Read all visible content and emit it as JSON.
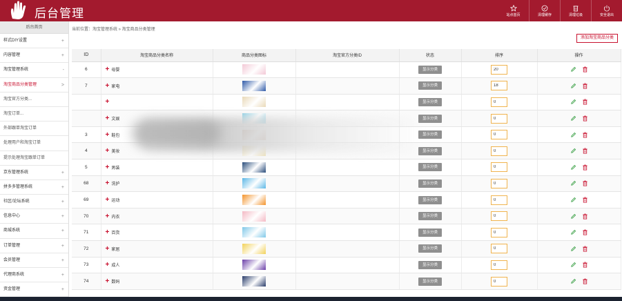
{
  "header": {
    "title": "后台管理",
    "nav": [
      {
        "label": "站点首页",
        "icon": "star-icon"
      },
      {
        "label": "清理缓存",
        "icon": "clear-cache-icon"
      },
      {
        "label": "清理垃圾",
        "icon": "trash-icon"
      },
      {
        "label": "安全退出",
        "icon": "power-icon"
      }
    ]
  },
  "sidebar": {
    "home": "后台首页",
    "items": [
      {
        "label": "样式DIY设置",
        "arrow": "+"
      },
      {
        "label": "内容管理",
        "arrow": "+"
      },
      {
        "label": "淘宝管理系统",
        "arrow": "-"
      },
      {
        "label": "淘宝商品分类管理",
        "arrow": ">",
        "active": true
      },
      {
        "label": "淘宝官方分类...",
        "arrow": ""
      },
      {
        "label": "淘宝订单...",
        "arrow": ""
      },
      {
        "label": "外部跟单淘宝订单",
        "arrow": ""
      },
      {
        "label": "处理用户和淘宝订单",
        "arrow": ""
      },
      {
        "label": "提示处理淘宝跟单订单",
        "arrow": ""
      },
      {
        "label": "京东管理系统",
        "arrow": "+"
      },
      {
        "label": "拼多多管理系统",
        "arrow": "+"
      },
      {
        "label": "社区/论坛系统",
        "arrow": "+"
      },
      {
        "label": "信息中心",
        "arrow": "+"
      },
      {
        "label": "商城系统",
        "arrow": "+"
      },
      {
        "label": "订单管理",
        "arrow": "+"
      },
      {
        "label": "会员管理",
        "arrow": "+"
      },
      {
        "label": "代理商系统",
        "arrow": "+"
      },
      {
        "label": "资金管理",
        "arrow": "+"
      }
    ]
  },
  "main": {
    "breadcrumb": "当前位置：淘宝管理系统 » 淘宝商品分类管理",
    "add_button": "添加淘宝商品分类",
    "columns": [
      "ID",
      "淘宝商品分类名称",
      "商品分类图标",
      "淘宝官方分类ID",
      "状态",
      "排序",
      "操作"
    ],
    "rows": [
      {
        "id": "6",
        "name": "母婴",
        "status": "显示分类",
        "sort": "20",
        "thumb_color": "#f3c9d6"
      },
      {
        "id": "7",
        "name": "家电",
        "status": "显示分类",
        "sort": "18",
        "thumb_color": "#2f5aa8"
      },
      {
        "id": "",
        "name": "",
        "status": "显示分类",
        "sort": "0",
        "thumb_color": "#e9d9b8"
      },
      {
        "id": "",
        "name": "文娱",
        "status": "显示分类",
        "sort": "0",
        "thumb_color": "#8fd3e8"
      },
      {
        "id": "3",
        "name": "鞋包",
        "status": "显示分类",
        "sort": "0",
        "thumb_color": "#d9b8a6"
      },
      {
        "id": "4",
        "name": "美妆",
        "status": "显示分类",
        "sort": "0",
        "thumb_color": "#efe2b9"
      },
      {
        "id": "5",
        "name": "男装",
        "status": "显示分类",
        "sort": "0",
        "thumb_color": "#2b4e7c"
      },
      {
        "id": "68",
        "name": "洗护",
        "status": "显示分类",
        "sort": "0",
        "thumb_color": "#5bb7e6"
      },
      {
        "id": "69",
        "name": "运动",
        "status": "显示分类",
        "sort": "0",
        "thumb_color": "#f3932b"
      },
      {
        "id": "70",
        "name": "内衣",
        "status": "显示分类",
        "sort": "0",
        "thumb_color": "#f4b9c4"
      },
      {
        "id": "71",
        "name": "百货",
        "status": "显示分类",
        "sort": "0",
        "thumb_color": "#7fc8e8"
      },
      {
        "id": "72",
        "name": "家居",
        "status": "显示分类",
        "sort": "0",
        "thumb_color": "#f2d25a"
      },
      {
        "id": "73",
        "name": "成人",
        "status": "显示分类",
        "sort": "0",
        "thumb_color": "#6b3fa8"
      },
      {
        "id": "74",
        "name": "数码",
        "status": "显示分类",
        "sort": "0",
        "thumb_color": "#2a3d6b"
      }
    ]
  },
  "colors": {
    "brand": "#a31a2e",
    "accent": "#c8102e",
    "status_button": "#8f8f8f",
    "edit_icon": "#2e9a3a",
    "delete_icon": "#c8102e"
  }
}
